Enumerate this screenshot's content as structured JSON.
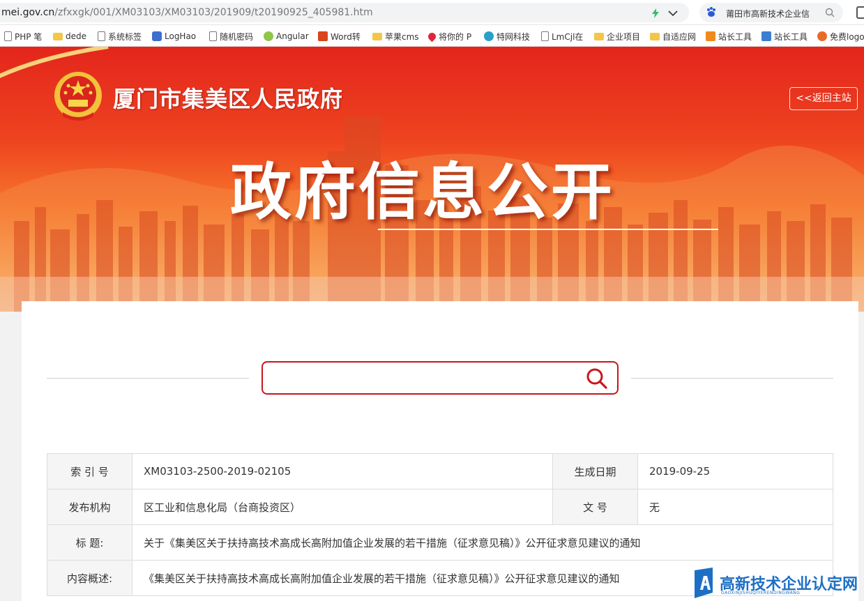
{
  "browser": {
    "url_host": "mei.gov.cn",
    "url_path": "/zfxxgk/001/XM03103/XM03103/201909/t20190925_405981.htm",
    "search_text": "莆田市高新技术企业信",
    "bookmarks": [
      {
        "label": "PHP 笔",
        "icon": "page-icon"
      },
      {
        "label": "dede",
        "icon": "folder-icon"
      },
      {
        "label": "系统标签",
        "icon": "page-icon"
      },
      {
        "label": "LogHao",
        "icon": "cube-icon"
      },
      {
        "label": "随机密码",
        "icon": "page-icon"
      },
      {
        "label": "Angular",
        "icon": "angular-icon"
      },
      {
        "label": "Word转",
        "icon": "word-icon"
      },
      {
        "label": "苹果cms",
        "icon": "folder-icon"
      },
      {
        "label": "将你的 P",
        "icon": "heart-icon"
      },
      {
        "label": "特网科技",
        "icon": "globe-icon"
      },
      {
        "label": "LmCjl在",
        "icon": "page-icon"
      },
      {
        "label": "企业项目",
        "icon": "folder-icon"
      },
      {
        "label": "自适应网",
        "icon": "folder-icon"
      },
      {
        "label": "站长工具",
        "icon": "tool-icon"
      },
      {
        "label": "站长工具",
        "icon": "chart-icon"
      },
      {
        "label": "免费logo",
        "icon": "circle-icon"
      }
    ]
  },
  "header": {
    "gov_name": "厦门市集美区人民政府",
    "back_label": "<<返回主站",
    "main_title": "政府信息公开"
  },
  "search": {
    "placeholder": ""
  },
  "info": {
    "index_label": "索 引 号",
    "index_value": "XM03103-2500-2019-02105",
    "date_label": "生成日期",
    "date_value": "2019-09-25",
    "org_label": "发布机构",
    "org_value": "区工业和信息化局（台商投资区）",
    "docno_label": "文 号",
    "docno_value": "无",
    "title_label": "标 题:",
    "title_value": "关于《集美区关于扶持高技术高成长高附加值企业发展的若干措施（征求意见稿）》公开征求意见建议的通知",
    "summary_label": "内容概述:",
    "summary_value": "《集美区关于扶持高技术高成长高附加值企业发展的若干措施（征求意见稿）》公开征求意见建议的通知"
  },
  "watermark": {
    "title": "高新技术企业认定网",
    "subtitle": "GAOXINJISHUQIYERENDINGWANG"
  },
  "colors": {
    "brand_red": "#c8161d",
    "banner_top": "#e3261c",
    "banner_mid": "#f7792b",
    "watermark_blue": "#1d6fc4"
  }
}
